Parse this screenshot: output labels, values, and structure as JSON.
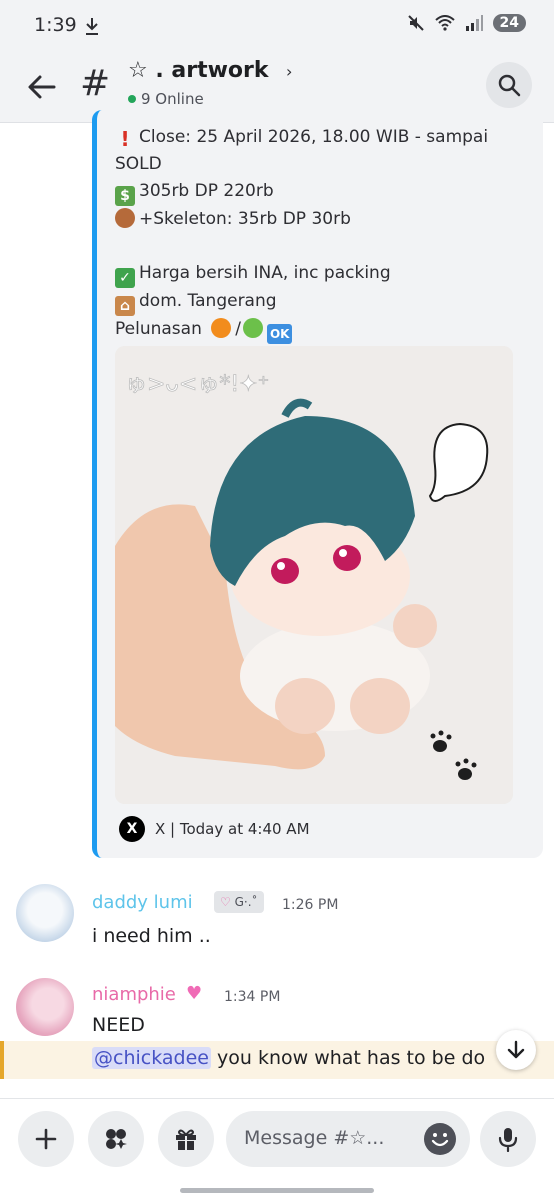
{
  "status_bar": {
    "time": "1:39",
    "battery": "24"
  },
  "header": {
    "channel_name": "☆ . artwork",
    "online_text": "9 Online"
  },
  "embed": {
    "lines": [
      "Close: 25 April 2026, 18.00 WIB - sampai",
      "SOLD",
      "305rb DP 220rb",
      "+Skeleton: 35rb DP 30rb",
      "Harga bersih INA, inc packing",
      "dom. Tangerang",
      "Pelunasan",
      "OK"
    ],
    "image_text": "ゅ>ᴗ<ゅ*!✦⁺",
    "footer": "X | Today at 4:40 AM",
    "x_logo": "X"
  },
  "messages": [
    {
      "author": "daddy lumi",
      "badge": "G·.˚",
      "time": "1:26 PM",
      "text": "i need him .."
    },
    {
      "author": "niamphie",
      "time": "1:34 PM",
      "text": "NEED"
    }
  ],
  "mention": {
    "handle": "@chickadee",
    "text": " you know what has to be do"
  },
  "composer": {
    "placeholder": "Message #☆..."
  },
  "colors": {
    "accent": "#1d9bf0",
    "author1": "#5ec4ea",
    "author2": "#e86aa8",
    "mention_bg": "#fbf3e3"
  },
  "icons": [
    "download-icon",
    "mute-icon",
    "wifi-icon",
    "signal-icon",
    "back-arrow-icon",
    "hash-icon",
    "chevron-right-icon",
    "search-icon",
    "x-logo-icon",
    "heart-icon",
    "arrow-down-icon",
    "plus-icon",
    "apps-icon",
    "gift-icon",
    "emoji-icon",
    "mic-icon"
  ]
}
